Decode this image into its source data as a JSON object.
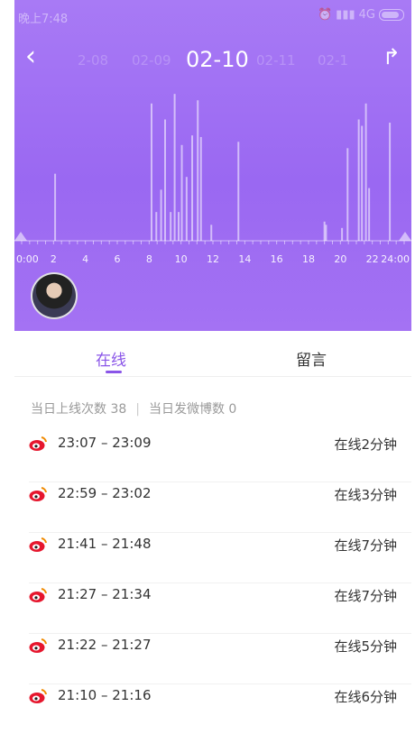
{
  "status_bar": {
    "time": "晚上7:48",
    "network": "4G"
  },
  "nav": {
    "dates": [
      "2-08",
      "02-09",
      "02-10",
      "02-11",
      "02-1"
    ],
    "current_index": 2
  },
  "tabs": {
    "online": "在线",
    "messages": "留言"
  },
  "summary": {
    "logins_label": "当日上线次数 38",
    "sep": "|",
    "posts_label": "当日发微博数 0"
  },
  "sessions": [
    {
      "range": "23:07 – 23:09",
      "duration": "在线2分钟"
    },
    {
      "range": "22:59 – 23:02",
      "duration": "在线3分钟"
    },
    {
      "range": "21:41 – 21:48",
      "duration": "在线7分钟"
    },
    {
      "range": "21:27 – 21:34",
      "duration": "在线7分钟"
    },
    {
      "range": "21:22 – 21:27",
      "duration": "在线5分钟"
    },
    {
      "range": "21:10 – 21:16",
      "duration": "在线6分钟"
    }
  ],
  "colors": {
    "accent": "#8a55e8",
    "hero": "#9a68f2",
    "weibo_red": "#e6162d"
  },
  "chart_data": {
    "type": "bar",
    "xlabel": "",
    "ylabel": "",
    "xlim": [
      0,
      24
    ],
    "ylim": [
      0,
      1
    ],
    "x_ticks": [
      "0:00",
      "2",
      "4",
      "6",
      "8",
      "10",
      "12",
      "14",
      "16",
      "18",
      "20",
      "22",
      "24:00"
    ],
    "bars": [
      {
        "x": 2.1,
        "y": 0.42
      },
      {
        "x": 8.15,
        "y": 0.86
      },
      {
        "x": 8.45,
        "y": 0.18
      },
      {
        "x": 8.75,
        "y": 0.32
      },
      {
        "x": 9.0,
        "y": 0.76
      },
      {
        "x": 9.35,
        "y": 0.18
      },
      {
        "x": 9.6,
        "y": 0.92
      },
      {
        "x": 9.85,
        "y": 0.18
      },
      {
        "x": 10.05,
        "y": 0.6
      },
      {
        "x": 10.35,
        "y": 0.4
      },
      {
        "x": 10.7,
        "y": 0.66
      },
      {
        "x": 11.05,
        "y": 0.88
      },
      {
        "x": 11.25,
        "y": 0.65
      },
      {
        "x": 11.9,
        "y": 0.1
      },
      {
        "x": 13.6,
        "y": 0.62
      },
      {
        "x": 19.0,
        "y": 0.12
      },
      {
        "x": 19.1,
        "y": 0.1
      },
      {
        "x": 20.1,
        "y": 0.08
      },
      {
        "x": 20.45,
        "y": 0.58
      },
      {
        "x": 21.15,
        "y": 0.76
      },
      {
        "x": 21.35,
        "y": 0.72
      },
      {
        "x": 21.6,
        "y": 0.86
      },
      {
        "x": 21.8,
        "y": 0.33
      },
      {
        "x": 23.1,
        "y": 0.74
      }
    ]
  }
}
